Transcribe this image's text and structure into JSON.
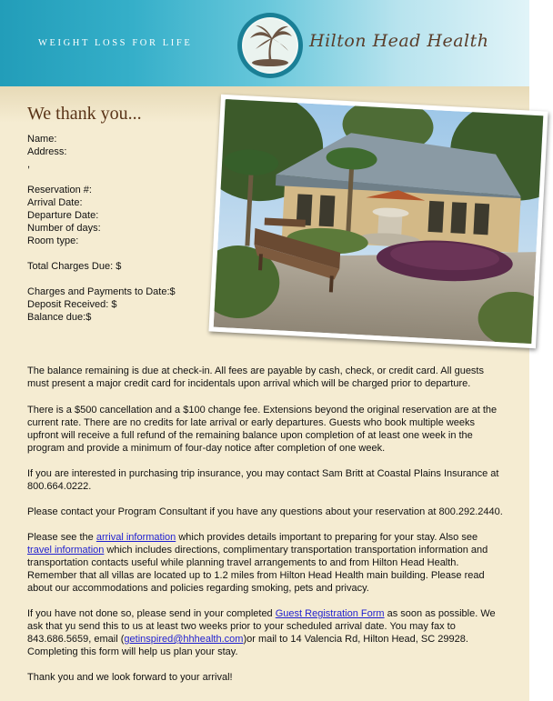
{
  "header": {
    "tagline": "WEIGHT LOSS FOR LIFE",
    "brand": "Hilton Head Health",
    "logo_icon": "palm-tree-icon",
    "colors": {
      "banner": "#229db9",
      "logo_ring": "#1a7f96",
      "brand_text": "#5a3e2b"
    }
  },
  "reservation": {
    "heading": "We thank you...",
    "name_label": "Name:",
    "address_label": "Address:",
    "address_line2": ",",
    "reservation_label": "Reservation #:",
    "arrival_label": "Arrival Date:",
    "departure_label": "Departure Date:",
    "days_label": "Number of days:",
    "room_label": "Room type:",
    "total_label": "Total Charges Due: $",
    "payments_label": "Charges and Payments to Date:$",
    "deposit_label": "Deposit Received: $",
    "balance_label": "Balance due:$"
  },
  "body": {
    "p1": "The balance remaining is due at check-in. All fees are payable by cash, check, or credit card. All guests must present a major credit card for incidentals upon arrival which will be charged prior to departure.",
    "p2": "There is a $500 cancellation and a $100 change fee. Extensions beyond the original reservation are at the current rate. There are no credits for late arrival or early departures. Guests who book multiple weeks upfront will receive a full refund of the remaining balance upon completion of at least one week in the program and provide a minimum of four-day notice after completion of one week.",
    "p3": "If you are interested in purchasing trip insurance, you may contact Sam Britt at Coastal Plains Insurance at 800.664.0222.",
    "p4": "Please contact your Program Consultant if you have any questions about your reservation at 800.292.2440.",
    "p5_a": "Please see the ",
    "p5_link1": "arrival information",
    "p5_b": " which provides details important to preparing for your stay. Also see ",
    "p5_link2": "travel information",
    "p5_c": " which includes directions, complimentary transportation transportation information and transportation contacts useful while planning travel arrangements to and from Hilton Head Health. Remember that all villas are located up to 1.2 miles from Hilton Head Health main building. Please read about our accommodations and policies regarding smoking, pets and privacy.",
    "p6_a": "If you have not done so, please send in your completed ",
    "p6_link": "Guest Registration Form",
    "p6_b": " as soon as possible. We ask that yu send this to us at least two weeks prior to your scheduled arrival date. You may fax to 843.686.5659, email (",
    "p6_email": "getinspired@hhhealth.com",
    "p6_c": ")or mail to 14 Valencia Rd, Hilton Head, SC 29928. Completing this form will help us plan your stay.",
    "p7": "Thank you and we look forward to your arrival!"
  },
  "link_color": "#1f1fd0",
  "page_bg": "#f5ecd2"
}
